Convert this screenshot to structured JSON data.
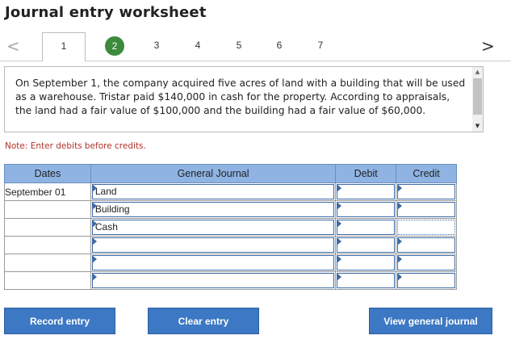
{
  "title": "Journal entry worksheet",
  "tabs": [
    {
      "label": "1"
    },
    {
      "label": "2",
      "state": "completed"
    },
    {
      "label": "3"
    },
    {
      "label": "4"
    },
    {
      "label": "5"
    },
    {
      "label": "6"
    },
    {
      "label": "7"
    }
  ],
  "nav": {
    "prev": "<",
    "next": ">"
  },
  "description": "On September 1, the company acquired five acres of land with a building that will be used as a warehouse. Tristar paid $140,000 in cash for the property. According to appraisals, the land had a fair value of $100,000 and the building had a fair value of $60,000.",
  "note": "Note: Enter debits before credits.",
  "table": {
    "headers": {
      "dates": "Dates",
      "journal": "General Journal",
      "debit": "Debit",
      "credit": "Credit"
    },
    "rows": [
      {
        "date": "September 01",
        "account": "Land",
        "debit": "",
        "credit": ""
      },
      {
        "date": "",
        "account": "Building",
        "debit": "",
        "credit": ""
      },
      {
        "date": "",
        "account": "Cash",
        "debit": "",
        "credit": ""
      },
      {
        "date": "",
        "account": "",
        "debit": "",
        "credit": ""
      },
      {
        "date": "",
        "account": "",
        "debit": "",
        "credit": ""
      },
      {
        "date": "",
        "account": "",
        "debit": "",
        "credit": ""
      }
    ]
  },
  "buttons": {
    "record": "Record entry",
    "clear": "Clear entry",
    "view": "View general journal"
  },
  "colors": {
    "accent": "#3c78c3",
    "header": "#8fb4e3",
    "completed": "#3c8a3c",
    "note": "#b0322c"
  }
}
